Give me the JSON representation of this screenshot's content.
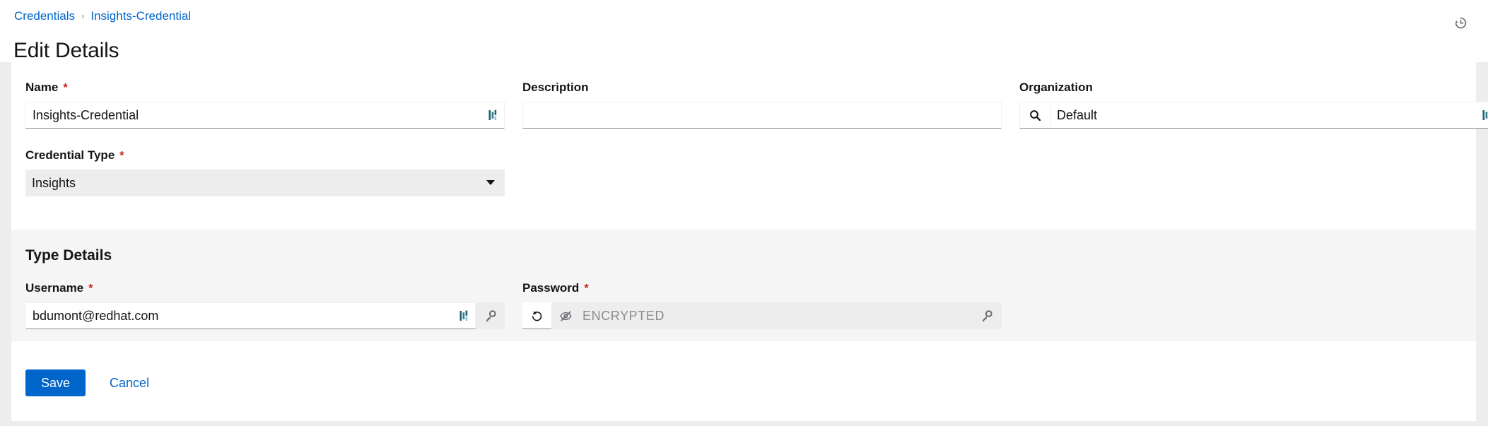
{
  "header": {
    "breadcrumb": {
      "parent": "Credentials",
      "separator": "›",
      "current": "Insights-Credential"
    },
    "title": "Edit Details",
    "history_icon": "history-revert-icon"
  },
  "form": {
    "name": {
      "label": "Name",
      "required": "*",
      "value": "Insights-Credential",
      "placeholder": "",
      "autofill_icon": "autofill-indicator-icon"
    },
    "description": {
      "label": "Description",
      "required": "",
      "value": "",
      "placeholder": ""
    },
    "organization": {
      "label": "Organization",
      "required": "",
      "value": "Default",
      "placeholder": "",
      "search_icon": "search-icon",
      "autofill_icon": "autofill-indicator-icon"
    },
    "credential_type": {
      "label": "Credential Type",
      "required": "*",
      "value": "Insights",
      "caret_icon": "chevron-down-icon",
      "options": [
        "Insights"
      ]
    }
  },
  "type_details": {
    "section_title": "Type Details",
    "username": {
      "label": "Username",
      "required": "*",
      "value": "bdumont@redhat.com",
      "placeholder": "",
      "autofill_icon": "autofill-indicator-icon",
      "key_icon": "key-icon"
    },
    "password": {
      "label": "Password",
      "required": "*",
      "value": "",
      "placeholder": "ENCRYPTED",
      "revert_icon": "revert-icon",
      "visibility_icon": "eye-slash-icon",
      "key_icon": "key-icon"
    }
  },
  "actions": {
    "save_label": "Save",
    "cancel_label": "Cancel"
  },
  "colors": {
    "accent": "#0066cc",
    "required": "#c9190b",
    "page_bg": "#ededed",
    "band_bg": "#f5f5f5",
    "autofill": "#1f6070"
  }
}
